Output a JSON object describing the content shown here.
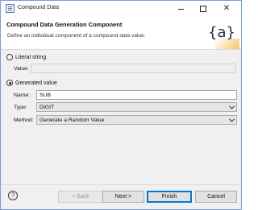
{
  "window": {
    "title": "Compound Data",
    "controls": {
      "minimize": "minimize",
      "maximize": "maximize",
      "close": "✕"
    }
  },
  "header": {
    "title": "Compound Data Generation Component",
    "description": "Define an individual component of a compound data value.",
    "logo": "{a}"
  },
  "literal": {
    "option_label": "Literal string",
    "value_label": "Value:",
    "value": "",
    "selected": false
  },
  "generated": {
    "option_label": "Generated value",
    "selected": true,
    "name_label": "Name:",
    "name_value": "SUB",
    "type_label": "Type:",
    "type_value": "DIGIT",
    "method_label": "Method:",
    "method_value": "Generate a Random Value"
  },
  "footer": {
    "help": "?",
    "back": "< Back",
    "next": "Next >",
    "finish": "Finish",
    "cancel": "Cancel"
  },
  "colors": {
    "accent": "#0078d7",
    "logo_highlight": "#f2bd4a"
  }
}
